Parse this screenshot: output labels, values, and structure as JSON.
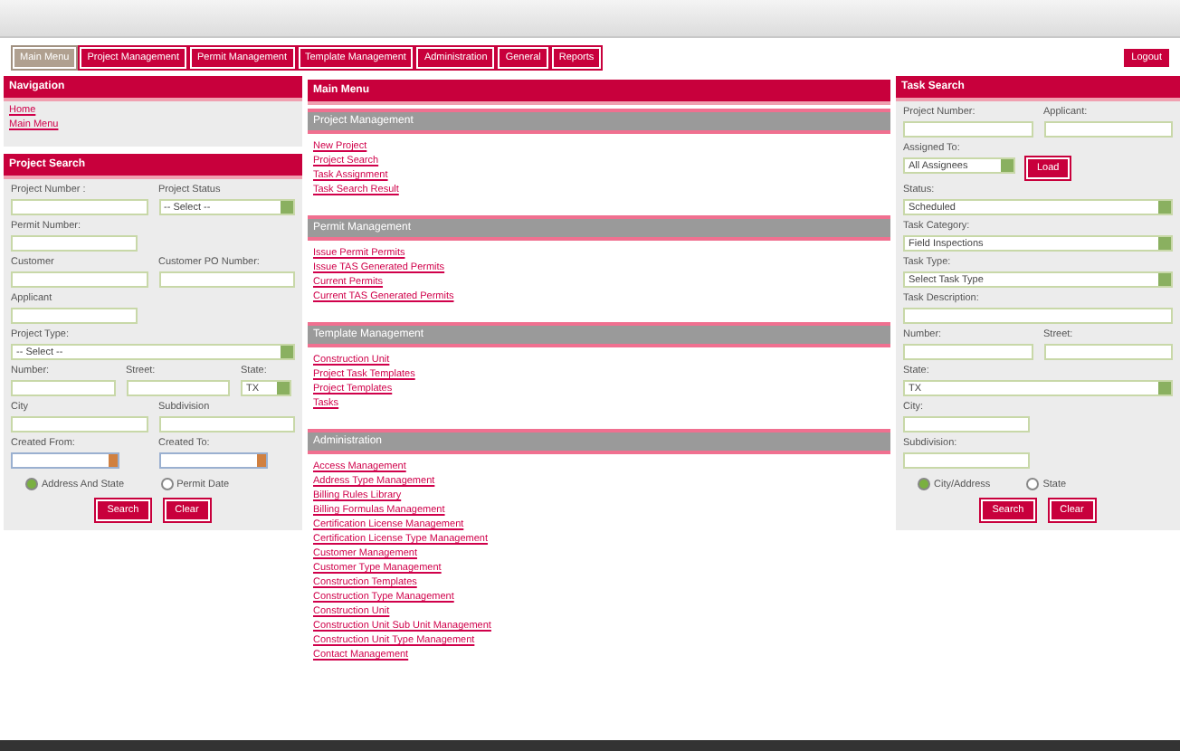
{
  "tabs": [
    {
      "label": "Main Menu",
      "selected": true
    },
    {
      "label": "Project Management",
      "selected": false
    },
    {
      "label": "Permit Management",
      "selected": false
    },
    {
      "label": "Template Management",
      "selected": false
    },
    {
      "label": "Administration",
      "selected": false
    },
    {
      "label": "General",
      "selected": false
    },
    {
      "label": "Reports",
      "selected": false
    }
  ],
  "logout": "Logout",
  "navigation": {
    "title": "Navigation",
    "links": [
      "Home",
      "Main Menu"
    ]
  },
  "project_search": {
    "title": "Project Search",
    "rows": [
      {
        "fields": [
          {
            "label": "Project Number :",
            "kind": "text"
          },
          {
            "label": "Project Status",
            "kind": "select",
            "value": "-- Select --"
          }
        ]
      },
      {
        "fields": [
          {
            "label": "Permit Number:",
            "kind": "text"
          }
        ]
      },
      {
        "fields": [
          {
            "label": "Customer",
            "kind": "text"
          },
          {
            "label": "Customer PO Number:",
            "kind": "text"
          }
        ]
      },
      {
        "fields": [
          {
            "label": "Applicant",
            "kind": "text"
          }
        ]
      },
      {
        "fields": [
          {
            "label": "Project Type:",
            "kind": "select",
            "value": "-- Select --"
          }
        ]
      },
      {
        "fields": [
          {
            "label": "Number:",
            "kind": "text"
          },
          {
            "label": "Street:",
            "kind": "text"
          },
          {
            "label": "State:",
            "kind": "state",
            "value": "TX"
          }
        ]
      },
      {
        "fields": [
          {
            "label": "City",
            "kind": "text"
          },
          {
            "label": "Subdivision",
            "kind": "text"
          }
        ]
      },
      {
        "fields": [
          {
            "label": "Created From:",
            "kind": "date"
          },
          {
            "label": "Created To:",
            "kind": "date"
          }
        ]
      }
    ],
    "radios": [
      {
        "label": "Address And State",
        "selected": true
      },
      {
        "label": "Permit Date",
        "selected": false
      }
    ],
    "buttons": [
      "Search",
      "Clear"
    ]
  },
  "main_menu": {
    "title": "Main Menu",
    "sections": [
      {
        "title": "Project Management",
        "links": [
          "New Project",
          "Project Search",
          "Task Assignment",
          "Task Search Result"
        ]
      },
      {
        "title": "Permit Management",
        "links": [
          "Issue Permit Permits",
          "Issue TAS Generated Permits",
          "Current Permits",
          "Current TAS Generated Permits"
        ]
      },
      {
        "title": "Template Management",
        "links": [
          "Construction Unit",
          "Project Task Templates",
          "Project Templates",
          "Tasks"
        ]
      },
      {
        "title": "Administration",
        "links": [
          "Access Management",
          "Address Type Management",
          "Billing Rules Library",
          "Billing Formulas Management",
          "Certification License Management",
          "Certification License Type Management",
          "Customer Management",
          "Customer Type Management",
          "Construction Templates",
          "Construction Type Management",
          "Construction Unit",
          "Construction Unit Sub Unit Management",
          "Construction Unit Type Management",
          "Contact Management"
        ]
      }
    ]
  },
  "task_search": {
    "title": "Task Search",
    "rows": [
      {
        "fields": [
          {
            "label": "Project Number:",
            "kind": "text"
          },
          {
            "label": "Applicant:",
            "kind": "text"
          }
        ]
      },
      {
        "fields": [
          {
            "label": "Assigned To:",
            "kind": "assign",
            "value": "All Assignees",
            "button": "Load"
          }
        ]
      },
      {
        "fields": [
          {
            "label": "Status:",
            "kind": "select",
            "value": "Scheduled"
          }
        ]
      },
      {
        "fields": [
          {
            "label": "Task Category:",
            "kind": "select",
            "value": "Field Inspections"
          }
        ]
      },
      {
        "fields": [
          {
            "label": "Task Type:",
            "kind": "select",
            "value": "Select Task Type"
          }
        ]
      },
      {
        "fields": [
          {
            "label": "Task Description:",
            "kind": "wide"
          }
        ]
      },
      {
        "fields": [
          {
            "label": "Number:",
            "kind": "text"
          },
          {
            "label": "Street:",
            "kind": "text"
          }
        ]
      },
      {
        "fields": [
          {
            "label": "State:",
            "kind": "select",
            "value": "TX"
          }
        ]
      },
      {
        "fields": [
          {
            "label": "City:",
            "kind": "text"
          }
        ]
      },
      {
        "fields": [
          {
            "label": "Subdivision:",
            "kind": "text"
          }
        ]
      }
    ],
    "radios": [
      {
        "label": "City/Address",
        "selected": true
      },
      {
        "label": "State",
        "selected": false
      }
    ],
    "buttons": [
      "Search",
      "Clear"
    ]
  }
}
